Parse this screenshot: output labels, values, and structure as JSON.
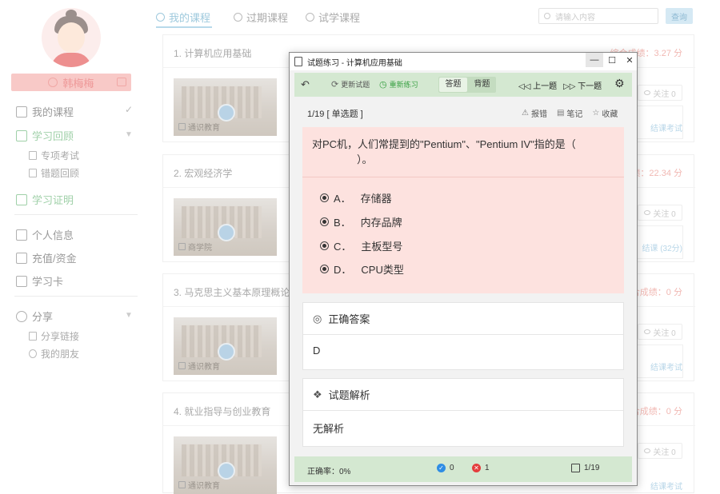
{
  "sidebar": {
    "username": "韩梅梅",
    "nav": {
      "my_courses": "我的课程",
      "study_review": "学习回顾",
      "special_exam": "专项考试",
      "wrong_review": "错题回顾",
      "certificate": "学习证明",
      "personal_info": "个人信息",
      "recharge": "充值/资金",
      "study_card": "学习卡",
      "share": "分享",
      "share_link": "分享链接",
      "my_friends": "我的朋友"
    }
  },
  "topbar": {
    "tabs": [
      "我的课程",
      "过期课程",
      "试学课程"
    ],
    "search_placeholder": "请输入内容",
    "search_button": "查询"
  },
  "courses": [
    {
      "title": "1. 计算机应用基础",
      "score": "综合成绩：3.27 分",
      "thumb_caption": "通识教育",
      "follow": "关注 0",
      "link": "结课考试"
    },
    {
      "title": "2. 宏观经济学",
      "score": "成绩：22.34 分",
      "thumb_caption": "商学院",
      "follow": "关注 0",
      "link": "结课 (32分)"
    },
    {
      "title": "3. 马克思主义基本原理概论",
      "score": "合成绩：0 分",
      "thumb_caption": "通识教育",
      "follow": "关注 0",
      "link": "结课考试"
    },
    {
      "title": "4. 就业指导与创业教育",
      "score": "合成绩：0 分",
      "thumb_caption": "通识教育",
      "follow": "关注 0",
      "link": "结课考试"
    }
  ],
  "modal": {
    "title": "试题练习 - 计算机应用基础",
    "toolbar": {
      "refresh": "更新试题",
      "redo": "重新练习",
      "seg_answer": "答题",
      "seg_memorize": "背题",
      "prev": "上一题",
      "next": "下一题"
    },
    "question_header": "1/19 [ 单选题 ]",
    "actions": {
      "report": "报错",
      "note": "笔记",
      "favorite": "收藏"
    },
    "question_line1": "对PC机，人们常提到的\"Pentium\"、\"Pentium IV\"指的是（",
    "question_line2": "）。",
    "options": [
      {
        "key": "A．",
        "text": "存储器"
      },
      {
        "key": "B．",
        "text": "内存品牌"
      },
      {
        "key": "C．",
        "text": "主板型号"
      },
      {
        "key": "D．",
        "text": "CPU类型"
      }
    ],
    "answer_title": "正确答案",
    "answer_value": "D",
    "analysis_title": "试题解析",
    "analysis_value": "无解析",
    "status": {
      "accuracy": "正确率：0%",
      "correct": "0",
      "wrong": "1",
      "page": "1/19"
    }
  }
}
